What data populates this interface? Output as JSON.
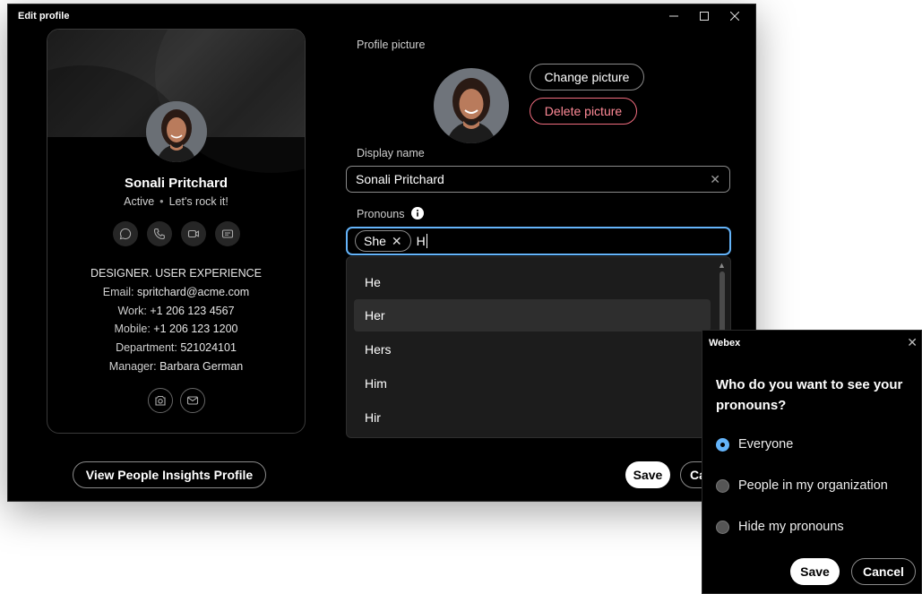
{
  "window": {
    "title": "Edit profile"
  },
  "card": {
    "name": "Sonali Pritchard",
    "status": "Active",
    "status_message": "Let's rock it!",
    "title": "DESIGNER. USER EXPERIENCE",
    "email_label": "Email:",
    "email": "spritchard@acme.com",
    "work_label": "Work:",
    "work": "+1 206 123 4567",
    "mobile_label": "Mobile:",
    "mobile": "+1 206 123 1200",
    "department_label": "Department:",
    "department": "521024101",
    "manager_label": "Manager:",
    "manager": "Barbara German"
  },
  "form": {
    "profile_picture_label": "Profile picture",
    "change_picture": "Change picture",
    "delete_picture": "Delete picture",
    "display_name_label": "Display name",
    "display_name_value": "Sonali Pritchard",
    "pronouns_label": "Pronouns",
    "pronoun_chip": "She",
    "pronoun_typed": "H",
    "suggestions": [
      "He",
      "Her",
      "Hers",
      "Him",
      "Hir"
    ],
    "hovered_suggestion": 1
  },
  "footer": {
    "view_insights": "View People Insights Profile",
    "save": "Save",
    "cancel": "Cancel"
  },
  "popup": {
    "title": "Webex",
    "question": "Who do you want to see your pronouns?",
    "options": [
      "Everyone",
      "People in my organization",
      "Hide my pronouns"
    ],
    "selected": 0,
    "save": "Save",
    "cancel": "Cancel"
  },
  "colors": {
    "accent": "#64b4fa",
    "danger": "#ff8a97",
    "background": "#000000"
  }
}
